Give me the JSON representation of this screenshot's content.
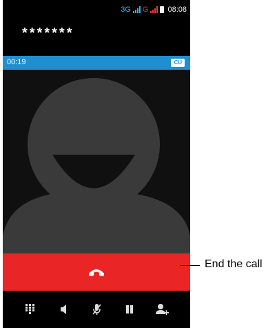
{
  "status_bar": {
    "network_1": "3G",
    "network_2": "G",
    "time": "08:08"
  },
  "call": {
    "number": "*******",
    "duration": "00:19",
    "carrier_badge": "CU"
  },
  "actions": {
    "end_call_icon": "phone-hangup-icon",
    "toolbar": [
      "dialpad-icon",
      "speaker-icon",
      "mute-icon",
      "hold-icon",
      "add-call-icon"
    ]
  },
  "annotation": {
    "end_call_label": "End the call"
  },
  "colors": {
    "end_call_bar": "#ea2526",
    "call_info_bar": "#1f8fd1",
    "network_3g": "#33b5e5",
    "network_g": "#e53935"
  }
}
